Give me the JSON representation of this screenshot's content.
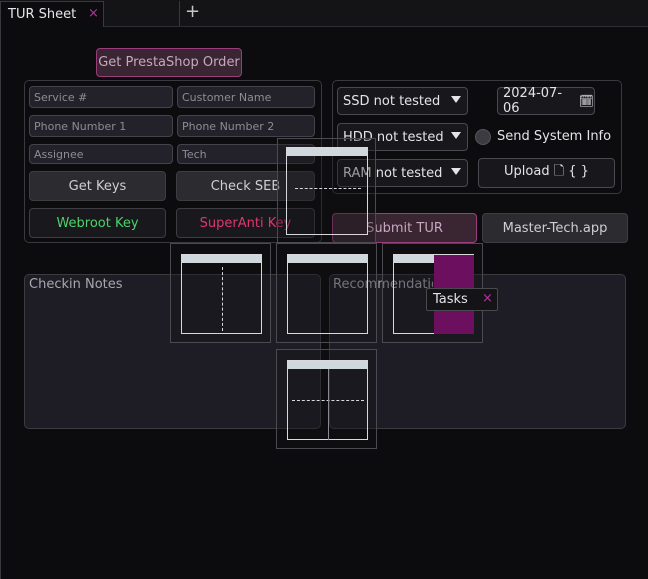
{
  "tab": {
    "title": "TUR Sheet",
    "close_glyph": "×",
    "add_glyph": "+"
  },
  "top_button": "Get PrestaShop Order",
  "inputs": {
    "service": "Service #",
    "customer": "Customer Name",
    "phone1": "Phone Number 1",
    "phone2": "Phone Number 2",
    "assignee": "Assignee",
    "tech": "Tech"
  },
  "buttons": {
    "get_keys": "Get Keys",
    "check_seb": "Check SEB",
    "webroot": "Webroot Key",
    "superanti": "SuperAnti Key",
    "submit": "Submit TUR",
    "master": "Master-Tech.app",
    "upload": "Upload 🗋 { }"
  },
  "selects": {
    "ssd": "SSD not tested",
    "hdd": "HDD not tested",
    "ram": "RAM not tested"
  },
  "date": {
    "value": "2024-07-06",
    "icon": "calendar-icon",
    "glyph": "🗓"
  },
  "send_system_info": {
    "label": "Send System Info",
    "checked": false
  },
  "notes": {
    "checkin": "Checkin Notes",
    "recommendations": "Recommendations"
  },
  "tasks_tab": {
    "label": "Tasks",
    "close_glyph": "×"
  },
  "colors": {
    "accent_pink": "#b1369f",
    "webroot_text": "#4cd36a",
    "superanti_text": "#e0366f",
    "dock_purple": "#6b0f5e"
  }
}
